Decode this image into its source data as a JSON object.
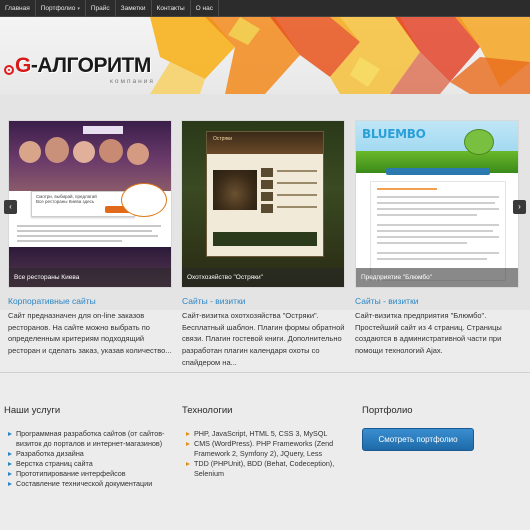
{
  "nav": {
    "items": [
      {
        "label": "Главная",
        "dropdown": false
      },
      {
        "label": "Портфолио",
        "dropdown": true
      },
      {
        "label": "Прайс",
        "dropdown": false
      },
      {
        "label": "Заметки",
        "dropdown": false
      },
      {
        "label": "Контакты",
        "dropdown": false
      },
      {
        "label": "О нас",
        "dropdown": false
      }
    ],
    "dropdown_arrow": "▾"
  },
  "logo": {
    "g_letter": "G",
    "name_rest": "-АЛГОРИТМ",
    "subtitle": "компания"
  },
  "slider": {
    "prev_icon": "‹",
    "next_icon": "›",
    "cards": [
      {
        "caption": "Все рестораны Киева",
        "screenshot_text": "Смотри, выбирай, предлагай\nВсе рестораны Киева здесь"
      },
      {
        "caption": "Охотхозяйство \"Остряки\"",
        "screenshot_text": "Остряки"
      },
      {
        "caption": "Предприятие \"Блюмбо\"",
        "screenshot_text": "BLUEMBO"
      }
    ]
  },
  "projects": [
    {
      "category": "Корпоративные сайты",
      "description": "Сайт предназначен для on-line заказов ресторанов. На сайте можно выбрать по определенным критериям подходящий ресторан и сделать заказ, указав количество..."
    },
    {
      "category": "Сайты - визитки",
      "description": "Сайт-визитка охотхозяйства \"Остряки\". Бесплатный шаблон. Плагин формы обратной связи. Плагин гостевой книги. Дополнительно разработан плагин календаря охоты со спайдером на..."
    },
    {
      "category": "Сайты - визитки",
      "description": "Сайт-визитка предприятия \"Блюмбо\". Простейший сайт из 4 страниц. Страницы создаются в административной части при помощи технологий Ajax."
    }
  ],
  "services": {
    "title": "Наши услуги",
    "items": [
      "Программная разработка сайтов (от сайтов-визиток до порталов и интернет-магазинов)",
      "Разработка дизайна",
      "Верстка страниц сайта",
      "Прототипирование интерфейсов",
      "Составление технической документации"
    ]
  },
  "technologies": {
    "title": "Технологии",
    "items": [
      "PHP, JavaScript, HTML 5, CSS 3, MySQL",
      "CMS (WordPress). PHP Frameworks (Zend Framework 2, Symfony 2), JQuery, Less",
      "TDD (PHPUnit), BDD (Behat, Codeception), Selenium"
    ]
  },
  "portfolio": {
    "title": "Портфолио",
    "button_label": "Смотреть портфолио"
  },
  "colors": {
    "accent": "#2a86c4",
    "brand_red": "#d61a1a",
    "nav_bg": "#2c2c2c",
    "button_blue": "#1e6aa8",
    "list_bullet_orange": "#e0921a"
  }
}
